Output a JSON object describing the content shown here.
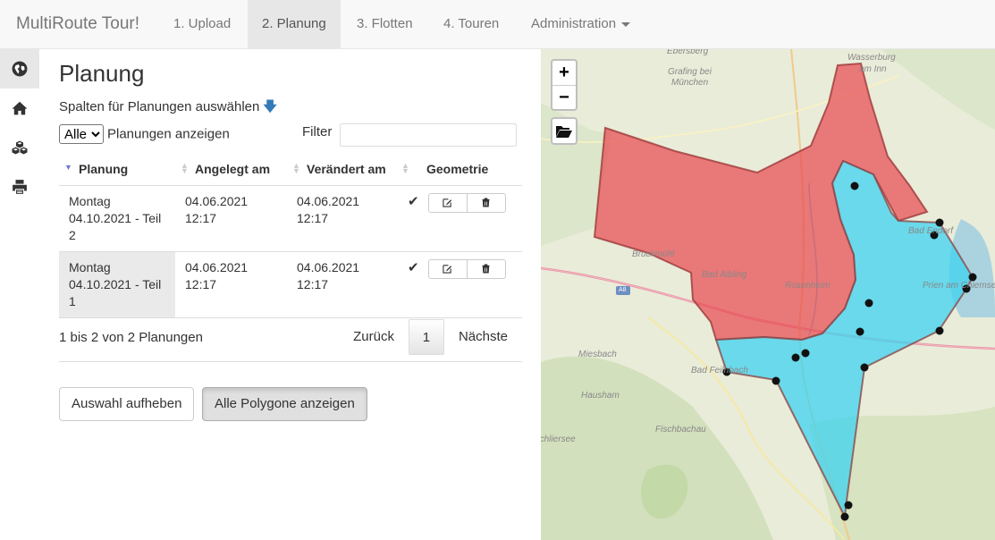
{
  "navbar": {
    "brand": "MultiRoute Tour!",
    "items": [
      {
        "label": "1. Upload",
        "active": false
      },
      {
        "label": "2. Planung",
        "active": true
      },
      {
        "label": "3. Flotten",
        "active": false
      },
      {
        "label": "4. Touren",
        "active": false
      },
      {
        "label": "Administration",
        "active": false
      }
    ]
  },
  "sidebar": {
    "icons": [
      "globe-icon",
      "home-icon",
      "cubes-icon",
      "print-icon"
    ]
  },
  "page": {
    "title": "Planung",
    "column_selector": "Spalten für Planungen auswählen",
    "length_value": "Alle",
    "length_suffix": "Planungen anzeigen",
    "filter_label": "Filter",
    "filter_value": ""
  },
  "table": {
    "headers": [
      "Planung",
      "Angelegt am",
      "Verändert am",
      "Geometrie"
    ],
    "rows": [
      {
        "planung": "Montag 04.10.2021 - Teil 2",
        "planung_lines": [
          "Montag",
          "04.10.2021 - Teil",
          "2"
        ],
        "angelegt": [
          "04.06.2021",
          "12:17"
        ],
        "veraendert": [
          "04.06.2021",
          "12:17"
        ],
        "geometrie": "✔"
      },
      {
        "planung": "Montag 04.10.2021 - Teil 1",
        "planung_lines": [
          "Montag",
          "04.10.2021 - Teil",
          "1"
        ],
        "angelegt": [
          "04.06.2021",
          "12:17"
        ],
        "veraendert": [
          "04.06.2021",
          "12:17"
        ],
        "geometrie": "✔"
      }
    ],
    "info": "1 bis 2 von 2 Planungen",
    "pager": {
      "prev": "Zurück",
      "page": "1",
      "next": "Nächste"
    }
  },
  "buttons": {
    "clear": "Auswahl aufheben",
    "show_all": "Alle Polygone anzeigen"
  },
  "map": {
    "zoom_in": "+",
    "zoom_out": "−",
    "labels": {
      "l1": "Ebersberg",
      "l2": "Wasserburg",
      "l3": "am Inn",
      "l4": "Grafing bei",
      "l5": "München",
      "l6": "Bad Endorf",
      "l7": "Bruckmühl",
      "l8": "Bad Aibling",
      "l9": "Rosenheim",
      "l10": "Prien am Chiemsee",
      "l11": "Miesbach",
      "l12": "Bad Feilnbach",
      "l13": "Hausham",
      "l14": "Fischbachau",
      "l15": "Schliersee",
      "l16": "A8"
    },
    "colors": {
      "red_polygon": "#e8474f",
      "blue_polygon": "#3dd3f0",
      "marker": "#111111"
    }
  }
}
